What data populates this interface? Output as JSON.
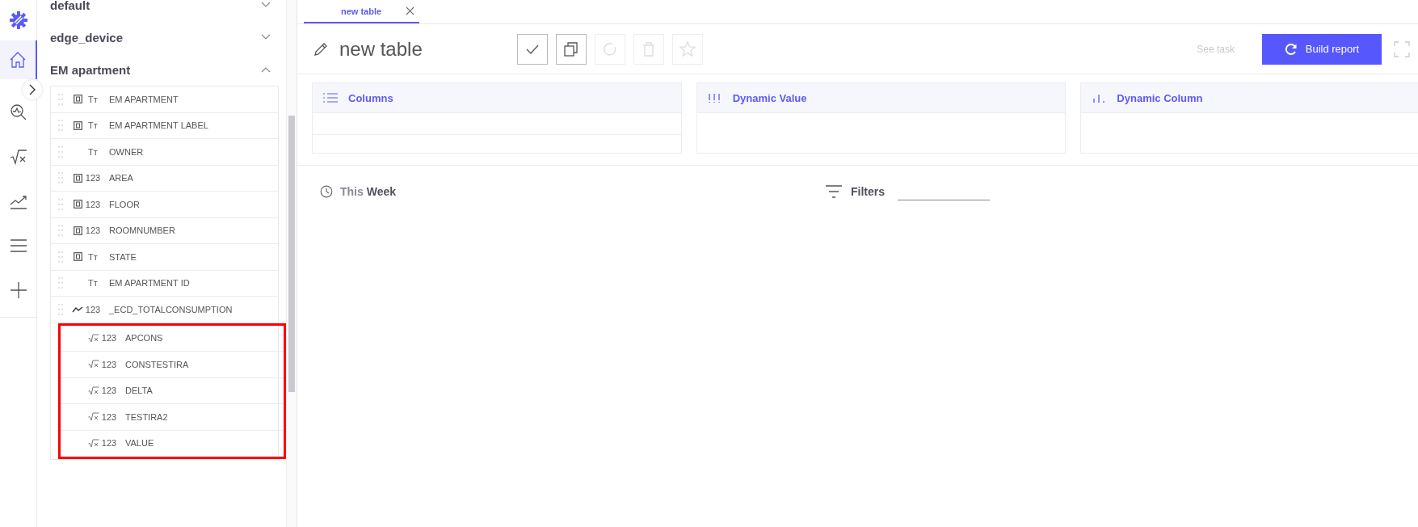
{
  "rail": {
    "items": [
      {
        "kind": "home",
        "selected": true
      },
      {
        "kind": "analytics",
        "selected": false
      },
      {
        "kind": "formula",
        "selected": false
      },
      {
        "kind": "trend",
        "selected": false
      },
      {
        "kind": "list",
        "selected": false
      },
      {
        "kind": "add",
        "selected": false
      }
    ]
  },
  "sidebar": {
    "groups": [
      {
        "title": "default",
        "expanded": false
      },
      {
        "title": "edge_device",
        "expanded": false
      },
      {
        "title": "EM apartment",
        "expanded": true,
        "fields": [
          {
            "name": "EM APARTMENT",
            "kind": "key",
            "type_glyph": "Tт",
            "highlighted": false
          },
          {
            "name": "EM APARTMENT LABEL",
            "kind": "key",
            "type_glyph": "Tт",
            "highlighted": false
          },
          {
            "name": "OWNER",
            "kind": "plain",
            "type_glyph": "Tт",
            "highlighted": false
          },
          {
            "name": "AREA",
            "kind": "key",
            "type_glyph": "123",
            "highlighted": false
          },
          {
            "name": "FLOOR",
            "kind": "key",
            "type_glyph": "123",
            "highlighted": false
          },
          {
            "name": "ROOMNUMBER",
            "kind": "key",
            "type_glyph": "123",
            "highlighted": false
          },
          {
            "name": "STATE",
            "kind": "key",
            "type_glyph": "Tт",
            "highlighted": false
          },
          {
            "name": "EM APARTMENT ID",
            "kind": "plain",
            "type_glyph": "Tт",
            "highlighted": false
          },
          {
            "name": "_ECD_TOTALCONSUMPTION",
            "kind": "timeseries",
            "type_glyph": "123",
            "highlighted": false
          },
          {
            "name": "APCONS",
            "kind": "formula",
            "type_glyph": "123",
            "highlighted": true
          },
          {
            "name": "CONSTESTIRA",
            "kind": "formula",
            "type_glyph": "123",
            "highlighted": true
          },
          {
            "name": "DELTA",
            "kind": "formula",
            "type_glyph": "123",
            "highlighted": true
          },
          {
            "name": "TESTIRA2",
            "kind": "formula",
            "type_glyph": "123",
            "highlighted": true
          },
          {
            "name": "VALUE",
            "kind": "formula",
            "type_glyph": "123",
            "highlighted": true
          }
        ]
      }
    ]
  },
  "tabs": [
    {
      "label": "new table",
      "selected": true
    }
  ],
  "report": {
    "title": "new table",
    "actions": [
      {
        "kind": "save",
        "disabled": false
      },
      {
        "kind": "copy",
        "disabled": false
      },
      {
        "kind": "refresh",
        "disabled": true
      },
      {
        "kind": "delete",
        "disabled": true
      },
      {
        "kind": "favorite",
        "disabled": true
      }
    ],
    "see_task": {
      "label": "See task",
      "disabled": true
    },
    "build_button": "Build report"
  },
  "panels": [
    {
      "kind": "columns",
      "title": "Columns"
    },
    {
      "kind": "value",
      "title": "Dynamic Value"
    },
    {
      "kind": "column",
      "title": "Dynamic Column"
    }
  ],
  "period": {
    "prefix": "This",
    "value": "Week"
  },
  "filters": {
    "label": "Filters"
  }
}
